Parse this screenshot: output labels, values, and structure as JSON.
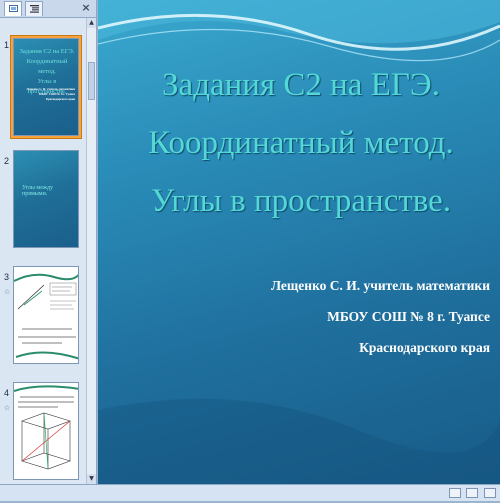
{
  "slide_pane": {
    "tab_slides_icon": "slides-icon",
    "tab_outline_icon": "outline-icon",
    "close_icon": "close-icon",
    "slides": [
      {
        "number": "1",
        "title_lines": [
          "Задания С2 на ЕГЭ.",
          "Координатный метод.",
          "Углы в пространстве."
        ],
        "author_lines": [
          "Лещенко С. И. учитель математики",
          "МБОУ СОШ № 8 г. Туапсе",
          "Краснодарского края"
        ]
      },
      {
        "number": "2",
        "text": "Углы между прямыми."
      },
      {
        "number": "3"
      },
      {
        "number": "4"
      }
    ]
  },
  "slide": {
    "title_lines": [
      "Задания С2 на ЕГЭ.",
      "Координатный  метод.",
      "Углы в пространстве."
    ],
    "author_lines": [
      "Лещенко С. И. учитель математики",
      "МБОУ СОШ № 8 г. Туапсе",
      "Краснодарского края"
    ]
  },
  "colors": {
    "title": "#53d8d5",
    "selected_thumb": "#f7a23b",
    "slide_bg": "#1f6f9d"
  }
}
